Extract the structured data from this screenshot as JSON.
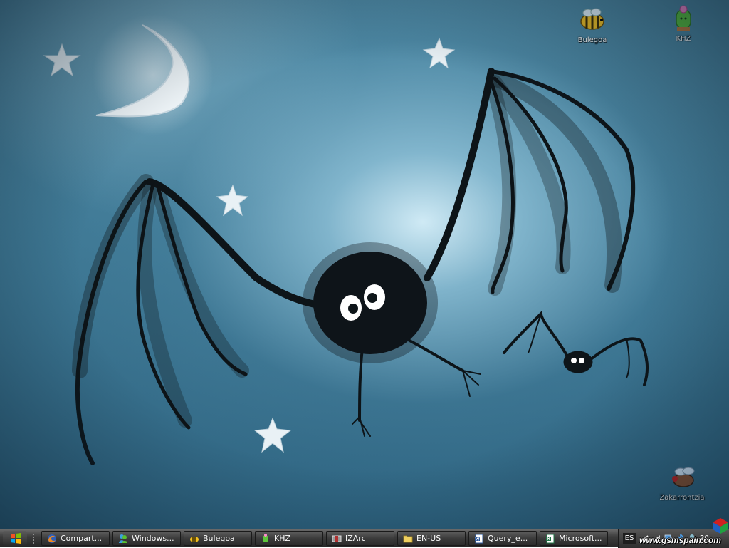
{
  "desktop": {
    "icons": [
      {
        "label": "Bulegoa",
        "icon": "bee-icon"
      },
      {
        "label": "KHZ",
        "icon": "cactus-icon"
      },
      {
        "label": "Zakarrontzia",
        "icon": "fly-icon"
      }
    ]
  },
  "taskbar": {
    "start": {
      "icon": "windows-logo-icon"
    },
    "buttons": [
      {
        "label": "Compart...",
        "icon": "firefox-icon"
      },
      {
        "label": "Windows...",
        "icon": "messenger-icon"
      },
      {
        "label": "Bulegoa",
        "icon": "bee-icon"
      },
      {
        "label": "KHZ",
        "icon": "cactus-icon"
      },
      {
        "label": "IZArc",
        "icon": "archive-icon"
      },
      {
        "label": "EN-US",
        "icon": "folder-icon"
      },
      {
        "label": "Query_e...",
        "icon": "word-document-icon"
      },
      {
        "label": "Microsoft...",
        "icon": "excel-icon"
      }
    ],
    "tray": {
      "language": "ES",
      "clock": "20"
    }
  },
  "watermark": {
    "text": "www.gsmspain.com"
  }
}
